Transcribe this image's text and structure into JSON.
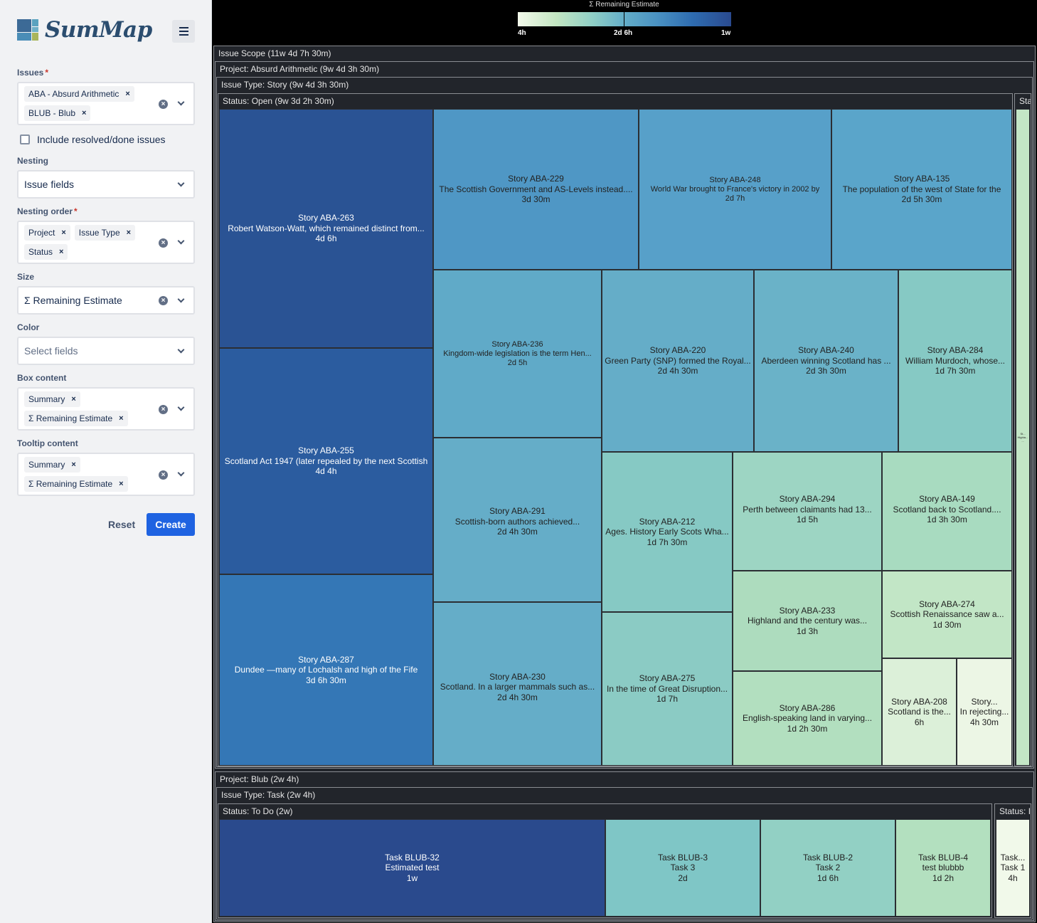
{
  "app": {
    "name": "SumMap",
    "menu_icon": "hamburger-icon"
  },
  "form": {
    "issues": {
      "label": "Issues",
      "required_mark": "*",
      "values": [
        "ABA - Absurd Arithmetic",
        "BLUB - Blub"
      ]
    },
    "include_resolved": {
      "label": "Include resolved/done issues",
      "checked": false
    },
    "nesting": {
      "label": "Nesting",
      "value": "Issue fields"
    },
    "nesting_order": {
      "label": "Nesting order",
      "required_mark": "*",
      "values": [
        "Project",
        "Issue Type",
        "Status"
      ]
    },
    "size": {
      "label": "Size",
      "value": "Σ Remaining Estimate"
    },
    "color": {
      "label": "Color",
      "placeholder": "Select fields"
    },
    "box_content": {
      "label": "Box content",
      "values": [
        "Summary",
        "Σ Remaining Estimate"
      ]
    },
    "tooltip_content": {
      "label": "Tooltip content",
      "values": [
        "Summary",
        "Σ Remaining Estimate"
      ]
    },
    "reset_label": "Reset",
    "create_label": "Create",
    "chip_remove": "×",
    "clear_glyph": "×"
  },
  "legend": {
    "title": "Σ Remaining Estimate",
    "min_label": "4h",
    "mid_label": "2d 6h",
    "max_label": "1w",
    "colors": [
      "#f3faeb",
      "#c3e6c2",
      "#8fcfc6",
      "#63adc8",
      "#4a92c2",
      "#2e6cb0",
      "#2a4a8f"
    ]
  },
  "treemap": {
    "root_label": "Issue Scope (11w 4d 7h 30m)",
    "projects": [
      {
        "label": "Project: Absurd Arithmetic (9w 4d 3h 30m)",
        "issue_types": [
          {
            "label": "Issue Type: Story (9w 4d 3h 30m)",
            "statuses": [
              {
                "label": "Status: Open (9w 3d 2h 30m)",
                "items": [
                  {
                    "type": "Story",
                    "key": "ABA-263",
                    "title": "Story ABA-263",
                    "summary": "Robert Watson-Watt, which remained distinct from...",
                    "estimate": "4d 6h",
                    "color": "#2a5394"
                  },
                  {
                    "type": "Story",
                    "key": "ABA-255",
                    "title": "Story ABA-255",
                    "summary": "Scotland Act 1947 (later repealed by the next Scottish",
                    "estimate": "4d 4h",
                    "color": "#2b5c9f"
                  },
                  {
                    "type": "Story",
                    "key": "ABA-287",
                    "title": "Story ABA-287",
                    "summary": "Dundee —many of Lochalsh and high of the Fife",
                    "estimate": "3d 6h 30m",
                    "color": "#3477b6"
                  },
                  {
                    "type": "Story",
                    "key": "ABA-229",
                    "title": "Story ABA-229",
                    "summary": "The Scottish Government and AS-Levels instead....",
                    "estimate": "3d 30m",
                    "color": "#4f97c5"
                  },
                  {
                    "type": "Story",
                    "key": "ABA-248",
                    "title": "Story ABA-248",
                    "summary": "World War brought to France's victory in 2002 by",
                    "estimate": "2d 7h",
                    "color": "#57a0c9"
                  },
                  {
                    "type": "Story",
                    "key": "ABA-135",
                    "title": "Story ABA-135",
                    "summary": "The population of the west of State for the",
                    "estimate": "2d 5h 30m",
                    "color": "#5aa5ca"
                  },
                  {
                    "type": "Story",
                    "key": "ABA-236",
                    "title": "Story ABA-236",
                    "summary": "Kingdom-wide legislation is the term Hen...",
                    "estimate": "2d 5h",
                    "color": "#60aac8"
                  },
                  {
                    "type": "Story",
                    "key": "ABA-220",
                    "title": "Story ABA-220",
                    "summary": "Green Party (SNP) formed the Royal...",
                    "estimate": "2d 4h 30m",
                    "color": "#65adc8"
                  },
                  {
                    "type": "Story",
                    "key": "ABA-240",
                    "title": "Story ABA-240",
                    "summary": "Aberdeen winning Scotland has ...",
                    "estimate": "2d 3h 30m",
                    "color": "#6ab2c8"
                  },
                  {
                    "type": "Story",
                    "key": "ABA-284",
                    "title": "Story ABA-284",
                    "summary": "William Murdoch, whose...",
                    "estimate": "1d 7h 30m",
                    "color": "#86c9c4"
                  },
                  {
                    "type": "Story",
                    "key": "ABA-291",
                    "title": "Story ABA-291",
                    "summary": "Scottish-born authors achieved...",
                    "estimate": "2d 4h 30m",
                    "color": "#65adc8"
                  },
                  {
                    "type": "Story",
                    "key": "ABA-230",
                    "title": "Story ABA-230",
                    "summary": "Scotland. In a larger mammals such as...",
                    "estimate": "2d 4h 30m",
                    "color": "#65adc8"
                  },
                  {
                    "type": "Story",
                    "key": "ABA-212",
                    "title": "Story ABA-212",
                    "summary": "Ages. History Early Scots Wha...",
                    "estimate": "1d 7h 30m",
                    "color": "#86c9c4"
                  },
                  {
                    "type": "Story",
                    "key": "ABA-275",
                    "title": "Story ABA-275",
                    "summary": "In the time of Great Disruption...",
                    "estimate": "1d 7h",
                    "color": "#8bcbc4"
                  },
                  {
                    "type": "Story",
                    "key": "ABA-294",
                    "title": "Story ABA-294",
                    "summary": "Perth between claimants had 13...",
                    "estimate": "1d 5h",
                    "color": "#9dd5c3"
                  },
                  {
                    "type": "Story",
                    "key": "ABA-149",
                    "title": "Story ABA-149",
                    "summary": "Scotland back to Scotland....",
                    "estimate": "1d 3h 30m",
                    "color": "#a8dbc0"
                  },
                  {
                    "type": "Story",
                    "key": "ABA-233",
                    "title": "Story ABA-233",
                    "summary": "Highland and the century was...",
                    "estimate": "1d 3h",
                    "color": "#addcbe"
                  },
                  {
                    "type": "Story",
                    "key": "ABA-274",
                    "title": "Story ABA-274",
                    "summary": "Scottish Renaissance saw a...",
                    "estimate": "1d 30m",
                    "color": "#c2e6c6"
                  },
                  {
                    "type": "Story",
                    "key": "ABA-286",
                    "title": "Story ABA-286",
                    "summary": "English-speaking land in varying...",
                    "estimate": "1d 2h 30m",
                    "color": "#b2dfbf"
                  },
                  {
                    "type": "Story",
                    "key": "ABA-208",
                    "title": "Story ABA-208",
                    "summary": "Scotland is the...",
                    "estimate": "6h",
                    "color": "#dcf0d9"
                  },
                  {
                    "type": "Story",
                    "key": "",
                    "title": "Story...",
                    "summary": "In rejecting...",
                    "estimate": "4h 30m",
                    "color": "#ecf6e5"
                  }
                ]
              },
              {
                "label": "Sta",
                "items": [
                  {
                    "type": "Story",
                    "key": "",
                    "title": "St...",
                    "summary": "Highla...",
                    "estimate": "...",
                    "color": "#c3e6c6"
                  }
                ]
              }
            ]
          }
        ]
      },
      {
        "label": "Project: Blub (2w 4h)",
        "issue_types": [
          {
            "label": "Issue Type: Task (2w 4h)",
            "statuses": [
              {
                "label": "Status: To Do (2w)",
                "items": [
                  {
                    "type": "Task",
                    "key": "BLUB-32",
                    "title": "Task BLUB-32",
                    "summary": "Estimated test",
                    "estimate": "1w",
                    "color": "#2a4a8d"
                  },
                  {
                    "type": "Task",
                    "key": "BLUB-3",
                    "title": "Task BLUB-3",
                    "summary": "Task 3",
                    "estimate": "2d",
                    "color": "#7fc6c6"
                  },
                  {
                    "type": "Task",
                    "key": "BLUB-2",
                    "title": "Task BLUB-2",
                    "summary": "Task 2",
                    "estimate": "1d 6h",
                    "color": "#92d0c4"
                  },
                  {
                    "type": "Task",
                    "key": "BLUB-4",
                    "title": "Task BLUB-4",
                    "summary": "test blubbb",
                    "estimate": "1d 2h",
                    "color": "#b3e0bf"
                  }
                ]
              },
              {
                "label": "Status: I",
                "items": [
                  {
                    "type": "Task",
                    "key": "",
                    "title": "Task...",
                    "summary": "Task 1",
                    "estimate": "4h",
                    "color": "#f1f9ea"
                  }
                ]
              }
            ]
          }
        ]
      }
    ]
  }
}
